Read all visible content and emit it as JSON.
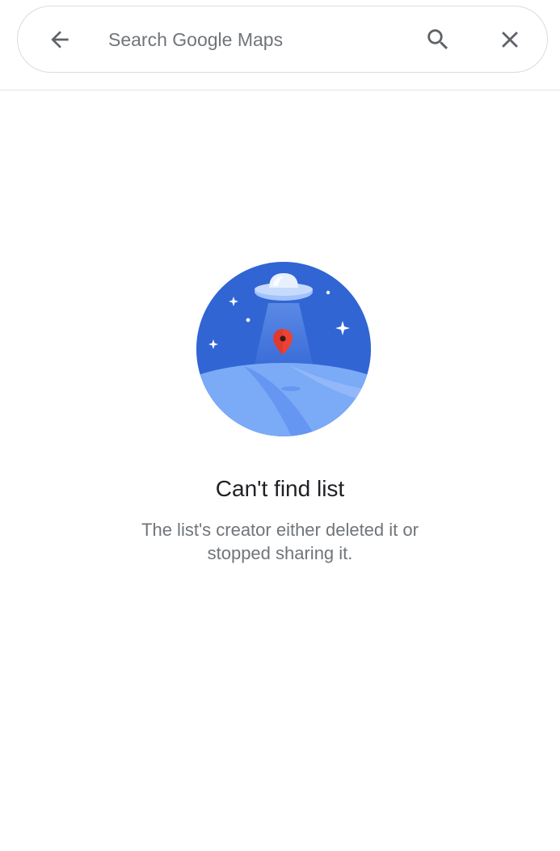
{
  "search": {
    "placeholder": "Search Google Maps",
    "value": ""
  },
  "icons": {
    "back": "arrow-back-icon",
    "search": "search-icon",
    "close": "close-icon",
    "illustration": "ufo-map-pin-illustration"
  },
  "empty_state": {
    "title": "Can't find list",
    "description": "The list's creator either deleted it or stopped sharing it."
  },
  "colors": {
    "icon": "#5f6368",
    "title_text": "#202124",
    "secondary_text": "#70757a",
    "sky_blue": "#3367d6",
    "ground_blue": "#7baaf7",
    "pin_red": "#ea4335"
  }
}
